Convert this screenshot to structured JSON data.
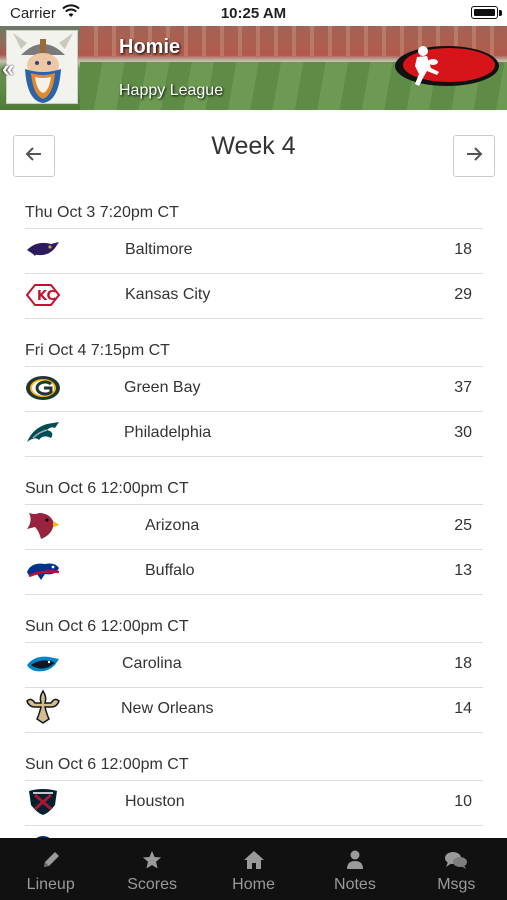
{
  "status_bar": {
    "carrier": "Carrier",
    "time": "10:25 AM"
  },
  "header": {
    "team_name": "Homie",
    "league_name": "Happy League"
  },
  "week_nav": {
    "title": "Week 4"
  },
  "games": [
    {
      "time": "Thu Oct 3 7:20pm CT",
      "teams": [
        {
          "name": "Baltimore",
          "score": "18",
          "icon": "ravens-logo"
        },
        {
          "name": "Kansas City",
          "score": "29",
          "icon": "chiefs-logo"
        }
      ]
    },
    {
      "time": "Fri Oct 4 7:15pm CT",
      "teams": [
        {
          "name": "Green Bay",
          "score": "37",
          "icon": "packers-logo"
        },
        {
          "name": "Philadelphia",
          "score": "30",
          "icon": "eagles-logo"
        }
      ]
    },
    {
      "time": "Sun Oct 6 12:00pm CT",
      "teams": [
        {
          "name": "Arizona",
          "score": "25",
          "icon": "cardinals-logo"
        },
        {
          "name": "Buffalo",
          "score": "13",
          "icon": "bills-logo"
        }
      ]
    },
    {
      "time": "Sun Oct 6 12:00pm CT",
      "teams": [
        {
          "name": "Carolina",
          "score": "18",
          "icon": "panthers-logo"
        },
        {
          "name": "New Orleans",
          "score": "14",
          "icon": "saints-logo"
        }
      ]
    },
    {
      "time": "Sun Oct 6 12:00pm CT",
      "teams": [
        {
          "name": "Houston",
          "score": "10",
          "icon": "texans-logo"
        },
        {
          "name": "",
          "score": "",
          "icon": "colts-logo"
        }
      ]
    }
  ],
  "tabs": [
    {
      "label": "Lineup",
      "icon": "pencil-icon"
    },
    {
      "label": "Scores",
      "icon": "star-icon"
    },
    {
      "label": "Home",
      "icon": "home-icon"
    },
    {
      "label": "Notes",
      "icon": "person-icon"
    },
    {
      "label": "Msgs",
      "icon": "chat-icon"
    }
  ],
  "colors": {
    "tab_bar_bg": "#111111",
    "tab_text": "#9a9a9a",
    "divider": "#dddddd"
  }
}
